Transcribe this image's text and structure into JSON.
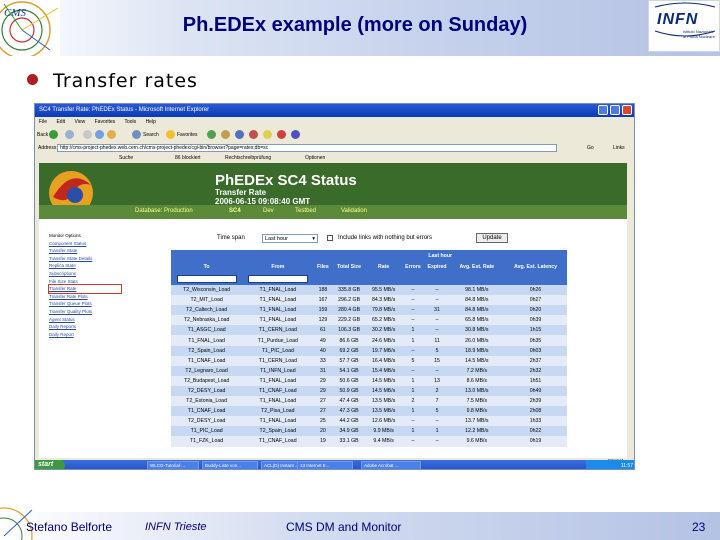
{
  "slide": {
    "title": "Ph.EDEx example (more on Sunday)",
    "bullet": "Transfer rates",
    "logo_left_text": "CMS",
    "logo_right_text": "INFN",
    "logo_right_sub": [
      "Istituto Nazionale",
      "di Fisica Nucleare"
    ],
    "accent_color": "#00007a",
    "bullet_color": "#ad1f1f"
  },
  "browser": {
    "window_title": "SC4 Transfer Rate: PhEDEx Status - Microsoft Internet Explorer",
    "menu": [
      "File",
      "Edit",
      "View",
      "Favorites",
      "Tools",
      "Help"
    ],
    "toolbar": {
      "back": "Back",
      "search": "Search",
      "favorites": "Favorites"
    },
    "address_label": "Address",
    "address_url": "http://cms-project-phedex.web.cern.ch/cms-project-phedex/cgi-bin/browser?page=rates;db=sc",
    "go_label": "Go",
    "links_label": "Links",
    "linksbar": {
      "search": "Suche",
      "blocked": "86 blockiert",
      "spellcheck": "Rechtschreibprüfung",
      "options": "Optionen"
    },
    "status_zone": "Internet"
  },
  "phedex": {
    "title": "PhEDEx SC4 Status",
    "subtitle": "Transfer Rate",
    "timestamp": "2006-06-15 09:08:40 GMT",
    "nav": {
      "database_label": "Database: Production",
      "sc4": "SC4",
      "dev": "Dev",
      "testbed": "Testbed",
      "validation": "Validation"
    },
    "sidebar": {
      "header": "Monitor Options",
      "items": [
        "Component Status",
        "Transfer State",
        "Transfer State Details",
        "Replica State",
        "Subscriptions",
        "File Size Stats",
        "Transfer Rate",
        "Transfer Rate Plots",
        "Transfer Queue Plots",
        "Transfer Quality Plots",
        "Agent Status",
        "Daily Reports",
        "Daily Report"
      ]
    },
    "timespan_label": "Time span",
    "timespan_value": "Last hour",
    "include_label": "Include links with nothing but errors",
    "update_button": "Update",
    "table": {
      "group_header": "Last hour",
      "headers": [
        "To",
        "From",
        "Files",
        "Total Size",
        "Rate",
        "Errors",
        "Expired",
        "Avg. Est. Rate",
        "Avg. Est. Latency"
      ],
      "rows": [
        [
          "T2_Wisconsin_Load",
          "T1_FNAL_Load",
          "188",
          "335.8 GB",
          "95.5 MB/s",
          "–",
          "–",
          "98.1 MB/s",
          "0h26"
        ],
        [
          "T2_MIT_Load",
          "T1_FNAL_Load",
          "167",
          "296.2 GB",
          "84.3 MB/s",
          "–",
          "–",
          "84.8 MB/s",
          "0h27"
        ],
        [
          "T2_Caltech_Load",
          "T1_FNAL_Load",
          "159",
          "280.4 GB",
          "79.8 MB/s",
          "–",
          "31",
          "84.8 MB/s",
          "0h20"
        ],
        [
          "T2_Nebraska_Load",
          "T1_FNAL_Load",
          "129",
          "229.2 GB",
          "65.2 MB/s",
          "–",
          "–",
          "65.8 MB/s",
          "0h39"
        ],
        [
          "T1_ASGC_Load",
          "T1_CERN_Load",
          "61",
          "106.3 GB",
          "30.2 MB/s",
          "1",
          "–",
          "30.8 MB/s",
          "1h15"
        ],
        [
          "T1_FNAL_Load",
          "T1_Purdue_Load",
          "49",
          "86.6 GB",
          "24.6 MB/s",
          "1",
          "11",
          "26.0 MB/s",
          "0h35"
        ],
        [
          "T2_Spain_Load",
          "T1_PIC_Load",
          "40",
          "69.2 GB",
          "19.7 MB/s",
          "–",
          "5",
          "18.9 MB/s",
          "0h03"
        ],
        [
          "T1_CNAF_Load",
          "T1_CERN_Load",
          "33",
          "57.7 GB",
          "16.4 MB/s",
          "5",
          "15",
          "14.5 MB/s",
          "2h37"
        ],
        [
          "T2_Legnaro_Load",
          "T1_INFN_Load",
          "31",
          "54.1 GB",
          "15.4 MB/s",
          "–",
          "–",
          "7.2 MB/s",
          "2h32"
        ],
        [
          "T2_Budapest_Load",
          "T1_FNAL_Load",
          "29",
          "50.6 GB",
          "14.5 MB/s",
          "1",
          "13",
          "8.6 MB/s",
          "1h51"
        ],
        [
          "T2_DESY_Load",
          "T1_CNAF_Load",
          "29",
          "50.9 GB",
          "14.5 MB/s",
          "1",
          "2",
          "13.0 MB/s",
          "0h49"
        ],
        [
          "T2_Estonia_Load",
          "T1_FNAL_Load",
          "27",
          "47.4 GB",
          "13.5 MB/s",
          "2",
          "7",
          "7.5 MB/s",
          "2h39"
        ],
        [
          "T1_CNAF_Load",
          "T2_Pisa_Load",
          "27",
          "47.3 GB",
          "13.5 MB/s",
          "1",
          "5",
          "9.8 MB/s",
          "2h08"
        ],
        [
          "T2_DESY_Load",
          "T1_FNAL_Load",
          "25",
          "44.2 GB",
          "12.6 MB/s",
          "–",
          "–",
          "13.7 MB/s",
          "1h33"
        ],
        [
          "T1_PIC_Load",
          "T2_Spain_Load",
          "20",
          "34.9 GB",
          "9.9 MB/s",
          "1",
          "1",
          "12.2 MB/s",
          "0h22"
        ],
        [
          "T1_FZK_Load",
          "T1_CNAF_Load",
          "19",
          "33.1 GB",
          "9.4 MB/s",
          "–",
          "–",
          "9.6 MB/s",
          "0h19"
        ]
      ]
    }
  },
  "taskbar": {
    "start": "start",
    "items": [
      "WLCG-Tutorial-...",
      "Buddy-Liste von...",
      "ACL(D) Instant ...",
      "13 Internet E...",
      "Adobe Acrobat ..."
    ],
    "clock": "11:57"
  },
  "footer": {
    "author": "Stefano Belforte",
    "institution": "INFN Trieste",
    "topic": "CMS DM and Monitor",
    "page": "23"
  }
}
